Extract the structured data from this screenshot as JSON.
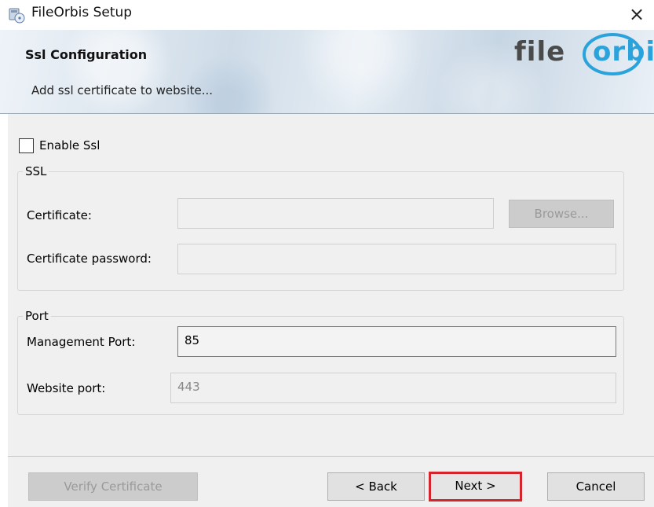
{
  "window": {
    "title": "FileOrbis Setup",
    "close_glyph": "×",
    "icon": "installer-disc-icon"
  },
  "banner": {
    "title": "Ssl Configuration",
    "subtitle": "Add ssl certificate to website...",
    "logo_text_left": "file",
    "logo_text_right": "orbis",
    "logo_colors": {
      "gray": "#4a4a4a",
      "blue": "#2aa3dc"
    }
  },
  "enable_ssl": {
    "label": "Enable Ssl",
    "checked": false
  },
  "ssl_group": {
    "label": "SSL",
    "certificate_label": "Certificate:",
    "certificate_value": "",
    "browse_label": "Browse...",
    "password_label": "Certificate password:",
    "password_value": ""
  },
  "port_group": {
    "label": "Port",
    "management_label": "Management Port:",
    "management_value": "85",
    "website_label": "Website port:",
    "website_value": "443"
  },
  "buttons": {
    "verify": "Verify Certificate",
    "back": "< Back",
    "next": "Next >",
    "cancel": "Cancel"
  },
  "colors": {
    "highlight": "#d4242c",
    "dialog_bg": "#f0f0f0"
  }
}
